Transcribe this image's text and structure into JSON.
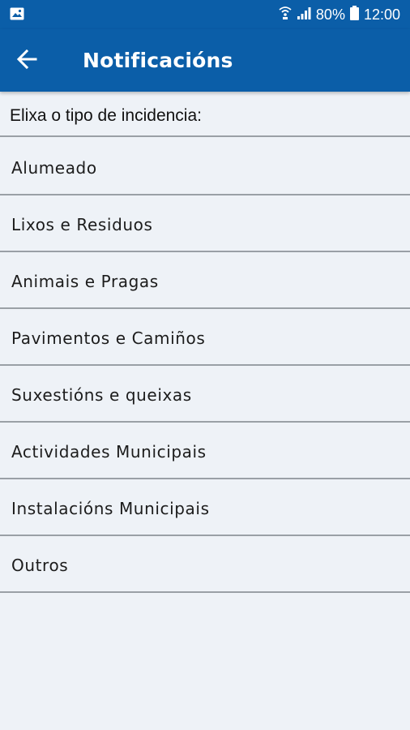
{
  "status_bar": {
    "battery_percent": "80%",
    "time": "12:00",
    "icons": [
      "image-icon",
      "wifi-calling-icon",
      "signal-icon",
      "battery-icon"
    ]
  },
  "app_bar": {
    "back_icon": "arrow-left-icon",
    "title": "Notificacións",
    "color": "#0b5ea8"
  },
  "prompt": "Elixa o tipo de incidencia:",
  "incident_types": [
    {
      "label": "Alumeado"
    },
    {
      "label": "Lixos e Residuos"
    },
    {
      "label": "Animais e Pragas"
    },
    {
      "label": "Pavimentos e Camiños"
    },
    {
      "label": "Suxestións e queixas"
    },
    {
      "label": "Actividades Municipais"
    },
    {
      "label": "Instalacións Municipais"
    },
    {
      "label": "Outros"
    }
  ]
}
